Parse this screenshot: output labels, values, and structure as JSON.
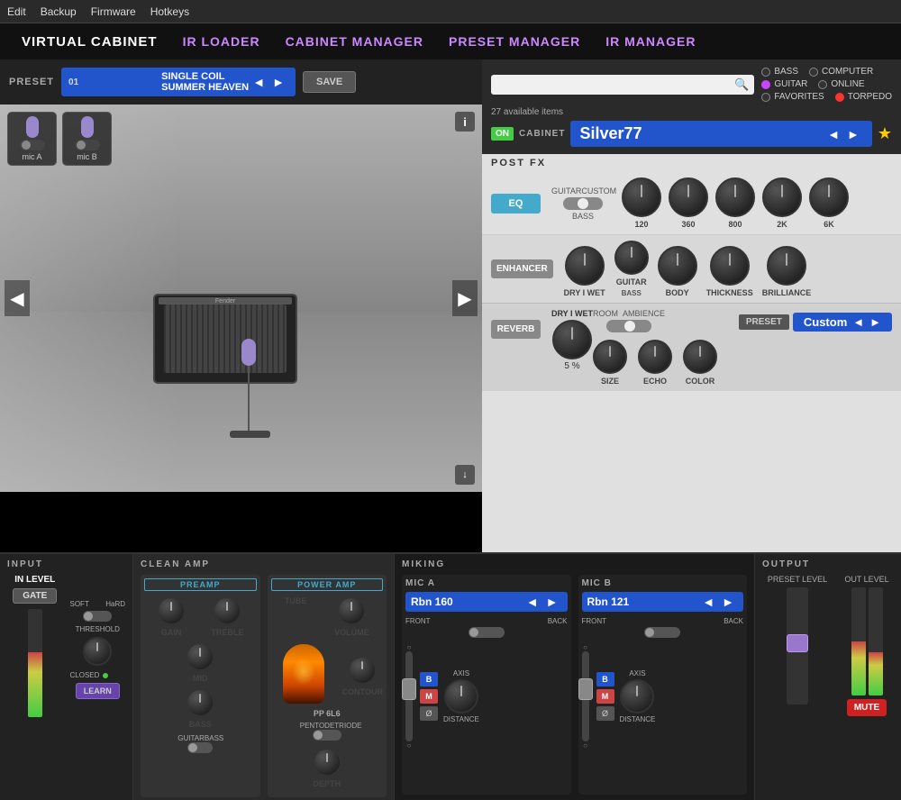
{
  "menu": {
    "items": [
      "Edit",
      "Backup",
      "Firmware",
      "Hotkeys"
    ]
  },
  "nav": {
    "tabs": [
      {
        "id": "virtual-cabinet",
        "label": "VIRTUAL CABINET",
        "active": true
      },
      {
        "id": "ir-loader",
        "label": "IR LOADER"
      },
      {
        "id": "cabinet-manager",
        "label": "CABINET MANAGER"
      },
      {
        "id": "preset-manager",
        "label": "PRESET MANAGER"
      },
      {
        "id": "ir-manager",
        "label": "IR MANAGER"
      }
    ]
  },
  "preset": {
    "label": "PRESET",
    "number": "01",
    "name": "SINGLE COIL SUMMER HEAVEN",
    "save_label": "SAVE"
  },
  "cabinet_search": {
    "placeholder": "",
    "items_count": "27 available items",
    "radio_groups": {
      "col1": [
        "BASS",
        "GUITAR",
        "FAVORITES"
      ],
      "col2": [
        "COMPUTER",
        "ONLINE",
        "TORPEDO"
      ]
    },
    "active_radio_col1": "GUITAR",
    "active_radio_col2": "TORPEDO",
    "on_label": "ON",
    "cabinet_label": "CABINET",
    "cabinet_name": "Silver77"
  },
  "post_fx": {
    "title": "POST FX",
    "eq": {
      "button_label": "EQ",
      "toggle_left": "GUITAR",
      "toggle_right": "CUSTOM",
      "toggle_center": "BASS",
      "bands": [
        {
          "freq": "120"
        },
        {
          "freq": "360"
        },
        {
          "freq": "800"
        },
        {
          "freq": "2K"
        },
        {
          "freq": "6K"
        }
      ]
    },
    "enhancer": {
      "button_label": "ENHANCER",
      "knobs": [
        {
          "label": "DRY I WET"
        },
        {
          "label": "GUITAR"
        },
        {
          "label": "BODY"
        },
        {
          "label": "THICKNESS"
        },
        {
          "label": "BRILLIANCE"
        }
      ],
      "bass_label": "BASS"
    },
    "reverb": {
      "button_label": "REVERB",
      "dry_wet_label": "DRY I WET",
      "pct": "5 %",
      "room_label": "ROOM",
      "ambience_label": "AMBIENCE",
      "preset_label": "PRESET",
      "custom_label": "Custom",
      "knobs": [
        {
          "label": "SIZE"
        },
        {
          "label": "ECHO"
        },
        {
          "label": "COLOR"
        }
      ]
    }
  },
  "bottom": {
    "input": {
      "title": "INPUT",
      "in_level": "IN LEVEL",
      "gate_label": "GATE",
      "soft_label": "SOFT",
      "hard_label": "HaRD",
      "threshold_label": "THRESHOLD",
      "closed_label": "CLOSED",
      "learn_label": "LEARN"
    },
    "clean_amp": {
      "title": "CLEAN AMP",
      "preamp": {
        "label": "PREAMP",
        "knobs": [
          "GAIN",
          "TREBLE",
          "MID",
          "BASS"
        ],
        "toggle_labels": [
          "GUITAR",
          "BASS"
        ]
      },
      "power_amp": {
        "label": "POWER AMP",
        "knobs": [
          "TUBE",
          "VOLUME",
          "CONTOUR",
          "DEPTH"
        ],
        "tube_label": "PP 6L6",
        "toggle_labels": [
          "PENTODE",
          "TRIODE"
        ]
      }
    },
    "miking": {
      "title": "MIKING",
      "mic_a": {
        "title": "MIC A",
        "selector": "Rbn 160",
        "front_label": "FRONT",
        "back_label": "BACK",
        "axis_label": "AXIS",
        "distance_label": "DISTANCE"
      },
      "mic_b": {
        "title": "MIC B",
        "selector": "Rbn 121",
        "front_label": "FRONT",
        "back_label": "BACK",
        "axis_label": "AXIS",
        "distance_label": "DISTANCE"
      }
    },
    "output": {
      "title": "OUTPUT",
      "preset_level": "PRESET LEVEL",
      "out_level": "OUT LEVEL",
      "mute_label": "MUTE"
    }
  },
  "mic_thumbnails": {
    "mic_a": "mic A",
    "mic_b": "mic B"
  }
}
